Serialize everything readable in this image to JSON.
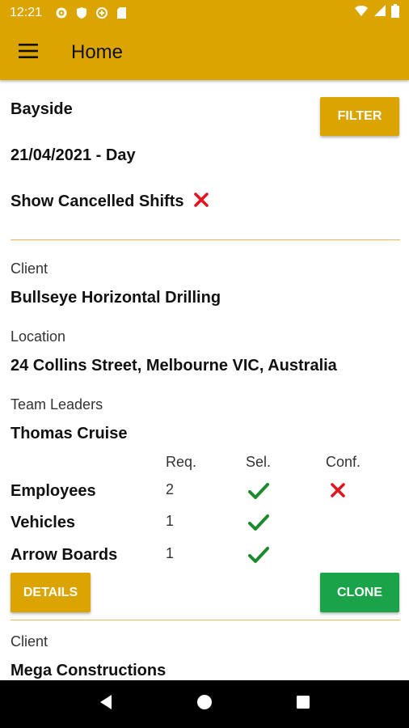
{
  "status_bar": {
    "time": "12:21"
  },
  "app_bar": {
    "title": "Home"
  },
  "filter": {
    "location": "Bayside",
    "date": "21/04/2021 - Day",
    "show_cancelled_label": "Show Cancelled Shifts",
    "filter_button": "FILTER"
  },
  "shifts": [
    {
      "client_label": "Client",
      "client": "Bullseye Horizontal Drilling",
      "location_label": "Location",
      "location": "24 Collins Street, Melbourne VIC, Australia",
      "team_leaders_label": "Team Leaders",
      "team_leaders": "Thomas Cruise",
      "columns": [
        "Req.",
        "Sel.",
        "Conf."
      ],
      "rows": [
        {
          "label": "Employees",
          "req": "2"
        },
        {
          "label": "Vehicles",
          "req": "1"
        },
        {
          "label": "Arrow Boards",
          "req": "1"
        }
      ],
      "details_button": "DETAILS",
      "clone_button": "CLONE"
    },
    {
      "client_label": "Client",
      "client": "Mega Constructions"
    }
  ],
  "colors": {
    "accent": "#dba400",
    "clone": "#1aa348",
    "cross": "#e4141e",
    "check": "#1e8a2e"
  }
}
